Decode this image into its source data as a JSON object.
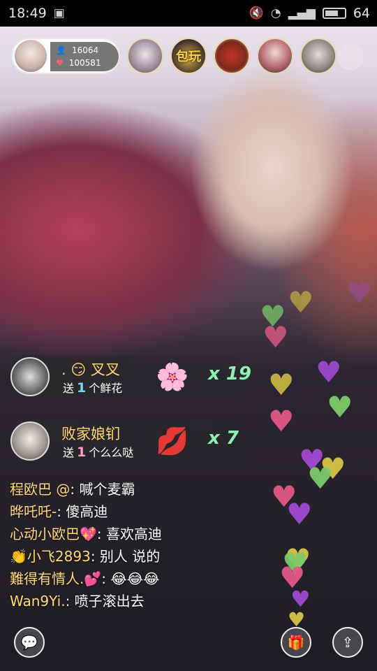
{
  "status_bar": {
    "time": "18:49",
    "battery": "64"
  },
  "host": {
    "viewers": "16064",
    "likes": "100581"
  },
  "viewer_banner_text": "包玩",
  "gifts": [
    {
      "name": ". 😏      叉叉",
      "prefix": "送",
      "count": "1",
      "suffix": "个鲜花",
      "icon": "🌸",
      "combo": "x 19"
    },
    {
      "name": "败家娘钔",
      "prefix": "送",
      "count": "1",
      "suffix": "个么么哒",
      "icon": "💋",
      "combo": "x 7"
    }
  ],
  "chat": [
    {
      "user": "程欧巴 @",
      "text": ": 喊个麦霸"
    },
    {
      "user": "晔吒吒-",
      "text": ": 傻高迪"
    },
    {
      "user": "心动小欧巴💖",
      "text": ": 喜欢高迪"
    },
    {
      "user": "👏小飞2893",
      "text": ": 别人 说的"
    },
    {
      "user": "難得有情人.💕",
      "text": ": 😂😂😂"
    },
    {
      "user": "Wan9Yi.",
      "text": ": 喷子滚出去"
    }
  ],
  "colors": {
    "heart_green": "#7bc96a",
    "heart_pink": "#e05a86",
    "heart_purple": "#a04ad3",
    "heart_yellow": "#d7c444"
  }
}
